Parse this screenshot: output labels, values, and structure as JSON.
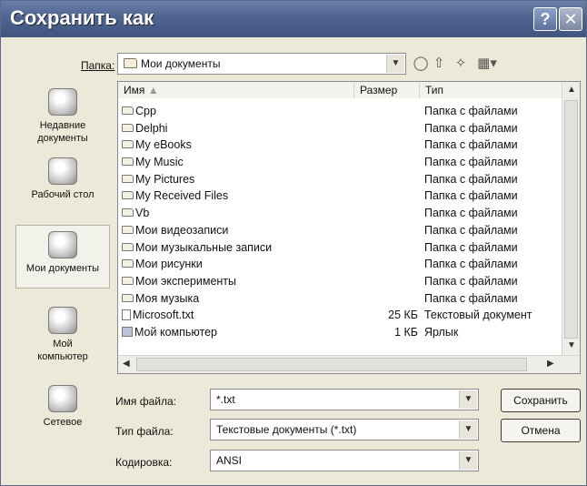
{
  "window": {
    "title": "Сохранить как",
    "help_glyph": "?",
    "close_glyph": "✕"
  },
  "toolbar": {
    "folder_label": "Папка:",
    "folder_value": "Мои документы",
    "icons": [
      "back-icon",
      "up-folder-icon",
      "new-folder-icon",
      "view-menu-icon"
    ]
  },
  "places": [
    {
      "label": "Недавние документы",
      "icon": "recent-documents-icon"
    },
    {
      "label": "Рабочий стол",
      "icon": "desktop-icon"
    },
    {
      "label": "Мои документы",
      "icon": "my-documents-icon",
      "active": true
    },
    {
      "label": "Мой компьютер",
      "icon": "my-computer-icon"
    },
    {
      "label": "Сетевое",
      "icon": "network-icon"
    }
  ],
  "columns": {
    "name": "Имя",
    "size": "Размер",
    "type": "Тип"
  },
  "files": [
    {
      "name": "Cpp",
      "size": "",
      "type": "Папка с файлами",
      "icon": "folder-icon"
    },
    {
      "name": "Delphi",
      "size": "",
      "type": "Папка с файлами",
      "icon": "folder-icon"
    },
    {
      "name": "My eBooks",
      "size": "",
      "type": "Папка с файлами",
      "icon": "folder-icon"
    },
    {
      "name": "My Music",
      "size": "",
      "type": "Папка с файлами",
      "icon": "folder-icon"
    },
    {
      "name": "My Pictures",
      "size": "",
      "type": "Папка с файлами",
      "icon": "folder-icon"
    },
    {
      "name": "My Received Files",
      "size": "",
      "type": "Папка с файлами",
      "icon": "folder-icon"
    },
    {
      "name": "Vb",
      "size": "",
      "type": "Папка с файлами",
      "icon": "folder-icon"
    },
    {
      "name": "Мои видеозаписи",
      "size": "",
      "type": "Папка с файлами",
      "icon": "folder-icon"
    },
    {
      "name": "Мои музыкальные записи",
      "size": "",
      "type": "Папка с файлами",
      "icon": "folder-icon"
    },
    {
      "name": "Мои рисунки",
      "size": "",
      "type": "Папка с файлами",
      "icon": "folder-icon"
    },
    {
      "name": "Мои эксперименты",
      "size": "",
      "type": "Папка с файлами",
      "icon": "folder-icon"
    },
    {
      "name": "Моя музыка",
      "size": "",
      "type": "Папка с файлами",
      "icon": "folder-icon"
    },
    {
      "name": "Microsoft.txt",
      "size": "25 КБ",
      "type": "Текстовый документ",
      "icon": "text-document-icon"
    },
    {
      "name": "Мой компьютер",
      "size": "1 КБ",
      "type": "Ярлык",
      "icon": "shortcut-icon"
    }
  ],
  "form": {
    "filename_label": "Имя файла:",
    "filename_value": "*.txt",
    "filetype_label": "Тип файла:",
    "filetype_value": "Текстовые документы (*.txt)",
    "encoding_label": "Кодировка:",
    "encoding_value": "ANSI",
    "save_label": "Сохранить",
    "cancel_label": "Отмена"
  }
}
